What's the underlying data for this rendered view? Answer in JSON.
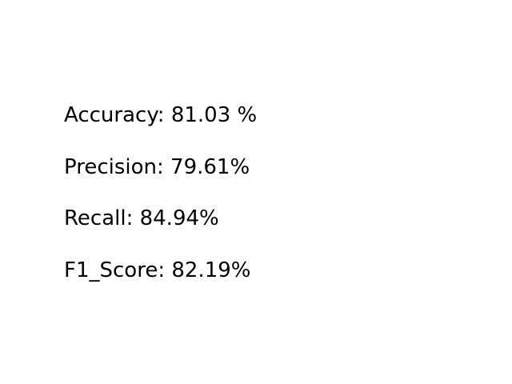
{
  "chart_data": {
    "type": "table",
    "title": "",
    "metrics": [
      {
        "label": "Accuracy",
        "value": 81.03,
        "unit": "%",
        "text": "Accuracy: 81.03 %"
      },
      {
        "label": "Precision",
        "value": 79.61,
        "unit": "%",
        "text": "Precision: 79.61%"
      },
      {
        "label": "Recall",
        "value": 84.94,
        "unit": "%",
        "text": "Recall: 84.94%"
      },
      {
        "label": "F1_Score",
        "value": 82.19,
        "unit": "%",
        "text": "F1_Score: 82.19%"
      }
    ],
    "axes": "off",
    "grid": false,
    "legend": "none"
  },
  "colors": {
    "background": "#ffffff",
    "text": "#000000"
  }
}
